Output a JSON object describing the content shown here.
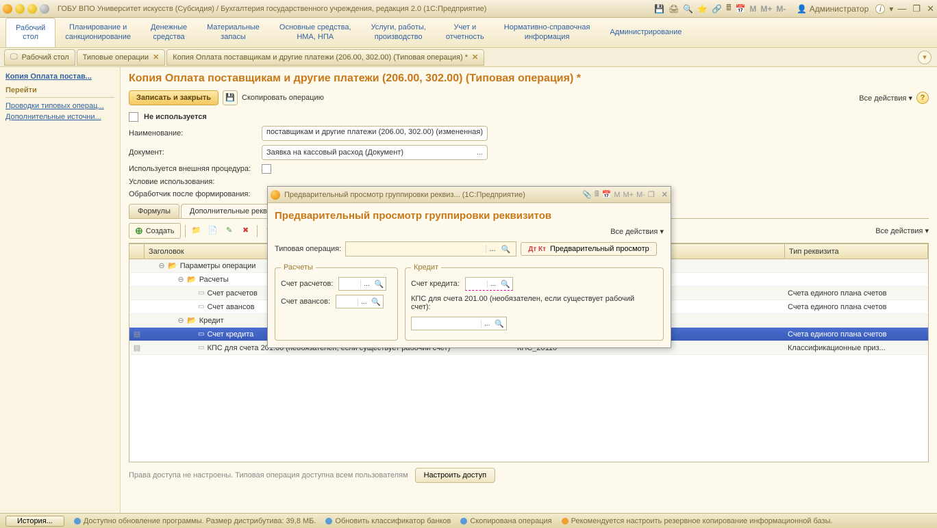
{
  "window": {
    "title": "ГОБУ ВПО Университет искусств (Субсидия) / Бухгалтерия государственного учреждения, редакция 2.0  (1С:Предприятие)",
    "user": "Администратор"
  },
  "sysMem": {
    "m": "M",
    "mplus": "M+",
    "mminus": "M-"
  },
  "mainNav": [
    {
      "l1": "Рабочий",
      "l2": "стол"
    },
    {
      "l1": "Планирование и",
      "l2": "санкционирование"
    },
    {
      "l1": "Денежные",
      "l2": "средства"
    },
    {
      "l1": "Материальные",
      "l2": "запасы"
    },
    {
      "l1": "Основные средства,",
      "l2": "НМА, НПА"
    },
    {
      "l1": "Услуги, работы,",
      "l2": "производство"
    },
    {
      "l1": "Учет и",
      "l2": "отчетность"
    },
    {
      "l1": "Нормативно-справочная",
      "l2": "информация"
    },
    {
      "l1": "Администрирование",
      "l2": ""
    }
  ],
  "tabs": [
    {
      "label": "Рабочий стол"
    },
    {
      "label": "Типовые операции"
    },
    {
      "label": "Копия Оплата поставщикам и другие платежи (206.00, 302.00) (Типовая операция) *"
    }
  ],
  "side": {
    "current": "Копия Оплата постав...",
    "section": "Перейти",
    "links": [
      "Проводки типовых операц...",
      "Дополнительные источни..."
    ]
  },
  "page": {
    "title": "Копия Оплата поставщикам и другие платежи (206.00, 302.00) (Типовая операция) *",
    "saveClose": "Записать и закрыть",
    "copyOp": "Скопировать операцию",
    "allActions": "Все действия",
    "notUsed": "Не используется",
    "fields": {
      "name": {
        "label": "Наименование:",
        "value": "поставщикам и другие платежи (206.00, 302.00) (измененная)"
      },
      "document": {
        "label": "Документ:",
        "value": "Заявка на кассовый расход (Документ)"
      },
      "extProc": {
        "label": "Используется внешняя процедура:"
      },
      "useCond": {
        "label": "Условие использования:"
      },
      "postHandler": {
        "label": "Обработчик после формирования:"
      }
    },
    "subTabs": [
      "Формулы",
      "Дополнительные рекв"
    ],
    "createBtn": "Создать",
    "table": {
      "headers": {
        "title": "Заголовок",
        "type": "Тип реквизита"
      },
      "rows": [
        {
          "level": 1,
          "folder": true,
          "exp": "⊖",
          "title": "Параметры операции",
          "check": "",
          "id": "",
          "type": ""
        },
        {
          "level": 2,
          "folder": true,
          "exp": "⊖",
          "title": "Расчеты",
          "check": "",
          "id": "",
          "type": ""
        },
        {
          "level": 3,
          "folder": false,
          "title": "Счет расчетов",
          "check": "",
          "id": "",
          "type": "Счета единого плана счетов"
        },
        {
          "level": 3,
          "folder": false,
          "title": "Счет авансов",
          "check": "",
          "id": "",
          "type": "Счета единого плана счетов"
        },
        {
          "level": 2,
          "folder": true,
          "exp": "⊖",
          "title": "Кредит",
          "check": "",
          "id": "ГруппаКредит",
          "type": ""
        },
        {
          "level": 3,
          "folder": false,
          "title": "Счет кредита",
          "check": "✔",
          "id": "СчетКт",
          "type": "Счета единого плана счетов",
          "selected": true
        },
        {
          "level": 3,
          "folder": false,
          "title": "КПС для счета 201.00 (необязателен, если существует рабочий счет)",
          "check": "",
          "id": "КПС_20110",
          "type": "Классификационные приз..."
        }
      ]
    },
    "accessText": "Права доступа не настроены. Типовая операция доступна всем пользователям",
    "setupAccess": "Настроить доступ"
  },
  "dialog": {
    "titleBar": "Предварительный просмотр группировки реквиз...   (1С:Предприятие)",
    "heading": "Предварительный просмотр группировки реквизитов",
    "allActions": "Все действия",
    "typOp": "Типовая операция:",
    "previewBtn": "Предварительный просмотр",
    "group1": {
      "legend": "Расчеты",
      "f1": "Счет расчетов:",
      "f2": "Счет авансов:"
    },
    "group2": {
      "legend": "Кредит",
      "f1": "Счет кредита:",
      "f2": "КПС для счета 201.00 (необязателен, если существует рабочий счет):"
    }
  },
  "statusBar": {
    "history": "История...",
    "items": [
      "Доступно обновление программы. Размер дистрибутива: 39,8 МБ.",
      "Обновить классификатор банков",
      "Скопирована операция",
      "Рекомендуется настроить резервное копирование информационной базы."
    ]
  },
  "dropdown": "▾",
  "dots": "...",
  "mag": "🔍"
}
